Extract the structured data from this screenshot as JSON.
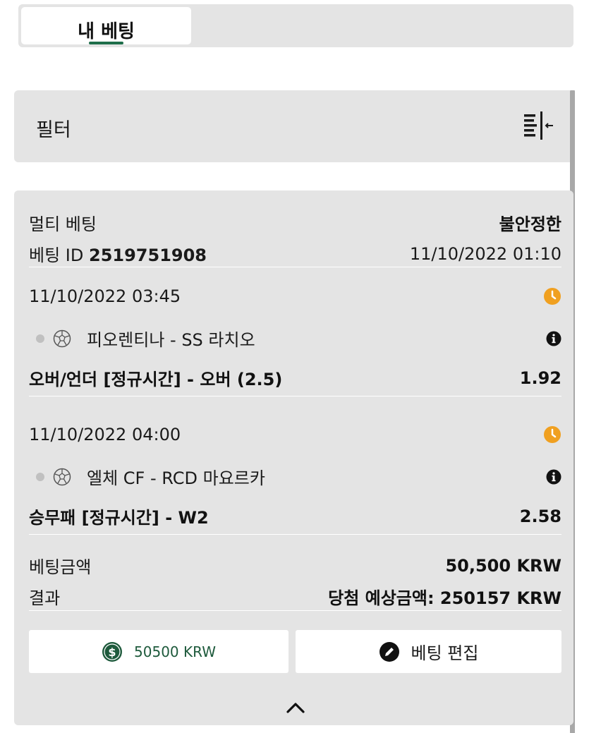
{
  "tabs": {
    "my_bets_label": "내 베팅"
  },
  "filter": {
    "label": "필터",
    "icon": "filter-collapse-icon"
  },
  "bet": {
    "type_label": "멀티 베팅",
    "status": "불안정한",
    "id_label": "베팅 ID",
    "id_value": "2519751908",
    "placed_at": "11/10/2022 01:10",
    "selections": [
      {
        "datetime": "11/10/2022 03:45",
        "event": "피오렌티나 - SS 라치오",
        "market": "오버/언더 [정규시간] - 오버 (2.5)",
        "odds": "1.92"
      },
      {
        "datetime": "11/10/2022 04:00",
        "event": "엘체 CF - RCD 마요르카",
        "market": "승무패 [정규시간] - W2",
        "odds": "2.58"
      }
    ],
    "stake_label": "베팅금액",
    "stake_value": "50,500 KRW",
    "result_label": "결과",
    "potential_win": "당첨 예상금액: 250157 KRW",
    "cashout_label": "50500  KRW",
    "edit_label": "베팅 편집"
  },
  "colors": {
    "accent_green": "#1e6e4a",
    "clock_orange": "#f0a020",
    "panel_gray": "#e4e4e4"
  }
}
